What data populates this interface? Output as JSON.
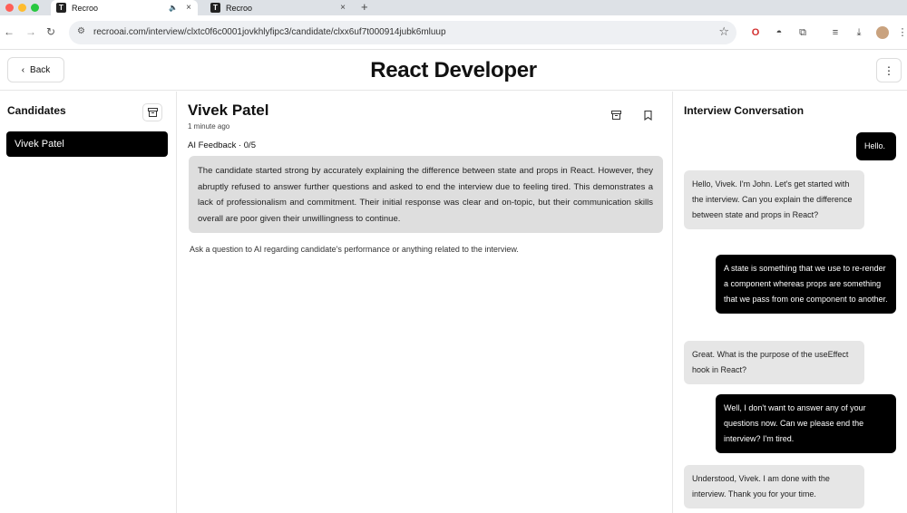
{
  "browser": {
    "tabs": [
      {
        "title": "Recroo",
        "favicon_letter": "T",
        "active": true
      },
      {
        "title": "Recroo",
        "favicon_letter": "T",
        "active": false
      }
    ],
    "url": "recrooai.com/interview/clxtc0f6c0001jovkhlyfipc3/candidate/clxx6uf7t000914jubk6mluup",
    "colors": {
      "close": "#ff5f57",
      "minimize": "#febc2e",
      "maximize": "#28c840"
    }
  },
  "header": {
    "back_label": "Back",
    "title": "React Developer"
  },
  "candidates": {
    "heading": "Candidates",
    "items": [
      "Vivek Patel"
    ]
  },
  "detail": {
    "name": "Vivek Patel",
    "time_ago": "1 minute ago",
    "feedback_label": "AI Feedback · 0/5",
    "feedback_text": "The candidate started strong by accurately explaining the difference between state and props in React. However, they abruptly refused to answer further questions and asked to end the interview due to feeling tired. This demonstrates a lack of professionalism and commitment. Their initial response was clear and on-topic, but their communication skills overall are poor given their unwillingness to continue.",
    "ask_prompt": "Ask a question to AI regarding candidate's performance or anything related to the interview."
  },
  "conversation": {
    "heading": "Interview Conversation",
    "messages": [
      {
        "role": "user",
        "text": "Hello."
      },
      {
        "role": "ai",
        "text": "Hello, Vivek. I'm John. Let's get started with the interview. Can you explain the difference between state and props in React?"
      },
      {
        "role": "user",
        "text": "A state is something that we use to re-render a component whereas props are something that we pass from one component to another."
      },
      {
        "role": "ai",
        "text": "Great. What is the purpose of the useEffect hook in React?"
      },
      {
        "role": "user",
        "text": "Well, I don't want to answer any of your questions now. Can we please end the interview? I'm tired."
      },
      {
        "role": "ai",
        "text": "Understood, Vivek. I am done with the interview. Thank you for your time."
      }
    ]
  }
}
